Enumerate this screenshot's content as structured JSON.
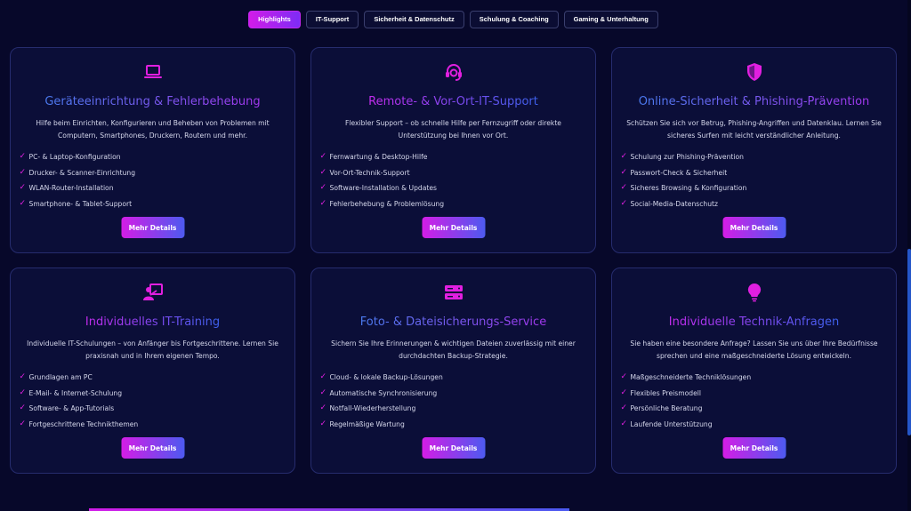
{
  "tabs": [
    {
      "label": "Highlights",
      "active": true
    },
    {
      "label": "IT-Support",
      "active": false
    },
    {
      "label": "Sicherheit & Datenschutz",
      "active": false
    },
    {
      "label": "Schulung & Coaching",
      "active": false
    },
    {
      "label": "Gaming & Unterhaltung",
      "active": false
    }
  ],
  "cards": [
    {
      "icon": "laptop-icon",
      "title": "Geräteeinrichtung & Fehlerbehebung",
      "description": "Hilfe beim Einrichten, Konfigurieren und Beheben von Problemen mit Computern, Smartphones, Druckern, Routern und mehr.",
      "features": [
        "PC- & Laptop-Konfiguration",
        "Drucker- & Scanner-Einrichtung",
        "WLAN-Router-Installation",
        "Smartphone- & Tablet-Support"
      ],
      "button": "Mehr Details"
    },
    {
      "icon": "headset-icon",
      "title": "Remote- & Vor-Ort-IT-Support",
      "description": "Flexibler Support – ob schnelle Hilfe per Fernzugriff oder direkte Unterstützung bei Ihnen vor Ort.",
      "features": [
        "Fernwartung & Desktop-Hilfe",
        "Vor-Ort-Technik-Support",
        "Software-Installation & Updates",
        "Fehlerbehebung & Problemlösung"
      ],
      "button": "Mehr Details"
    },
    {
      "icon": "shield-icon",
      "title": "Online-Sicherheit & Phishing-Prävention",
      "description": "Schützen Sie sich vor Betrug, Phishing-Angriffen und Datenklau. Lernen Sie sicheres Surfen mit leicht verständlicher Anleitung.",
      "features": [
        "Schulung zur Phishing-Prävention",
        "Passwort-Check & Sicherheit",
        "Sicheres Browsing & Konfiguration",
        "Social-Media-Datenschutz"
      ],
      "button": "Mehr Details"
    },
    {
      "icon": "teacher-icon",
      "title": "Individuelles IT-Training",
      "description": "Individuelle IT-Schulungen – von Anfänger bis Fortgeschrittene. Lernen Sie praxisnah und in Ihrem eigenen Tempo.",
      "features": [
        "Grundlagen am PC",
        "E-Mail- & Internet-Schulung",
        "Software- & App-Tutorials",
        "Fortgeschrittene Technikthemen"
      ],
      "button": "Mehr Details"
    },
    {
      "icon": "server-icon",
      "title": "Foto- & Dateisicherungs-Service",
      "description": "Sichern Sie Ihre Erinnerungen & wichtigen Dateien zuverlässig mit einer durchdachten Backup-Strategie.",
      "features": [
        "Cloud- & lokale Backup-Lösungen",
        "Automatische Synchronisierung",
        "Notfall-Wiederherstellung",
        "Regelmäßige Wartung"
      ],
      "button": "Mehr Details"
    },
    {
      "icon": "lightbulb-icon",
      "title": "Individuelle Technik-Anfragen",
      "description": "Sie haben eine besondere Anfrage? Lassen Sie uns über Ihre Bedürfnisse sprechen und eine maßgeschneiderte Lösung entwickeln.",
      "features": [
        "Maßgeschneiderte Technik­lösungen",
        "Flexibles Preismodell",
        "Persönliche Beratung",
        "Laufende Unterstützung"
      ],
      "button": "Mehr Details"
    }
  ],
  "colors": {
    "background": "#07082a",
    "card": "#0b0e38",
    "accent_pink": "#d21ce8",
    "accent_blue": "#4a5af0"
  }
}
